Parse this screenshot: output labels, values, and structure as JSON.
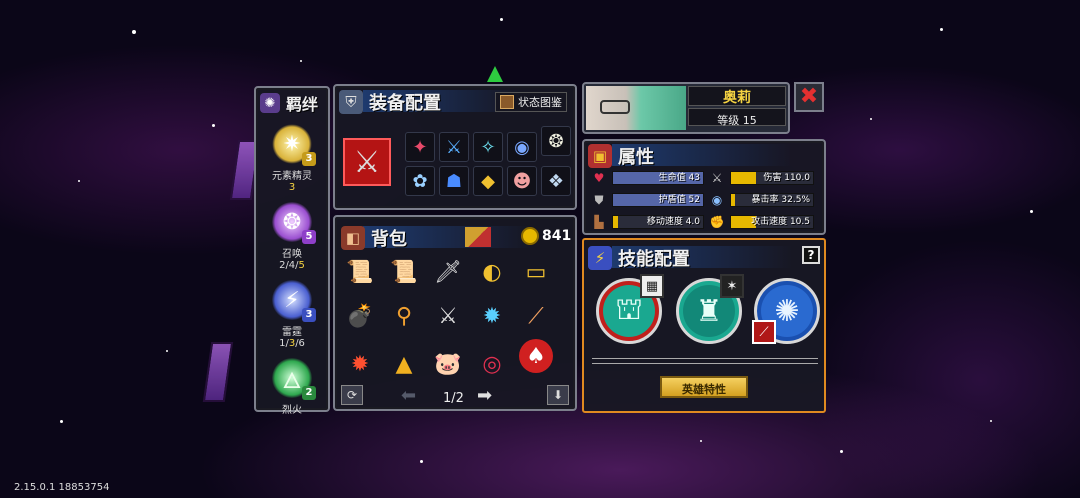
{
  "colors": {
    "panel_border": "#7c7f8c",
    "accent_gold": "#f5d342",
    "skill_panel_border": "#e08a20",
    "close_red": "#c62828",
    "hp_fill": "#5566a8",
    "gold_fill": "#e6b800"
  },
  "bond": {
    "title": "羁绊",
    "items": [
      {
        "name": "元素精灵",
        "count": "3",
        "badge": "3",
        "icon": "sun-star-icon"
      },
      {
        "name": "召唤",
        "count_parts": [
          "2/4/",
          "5"
        ],
        "badge": "5",
        "icon": "summon-swirl-icon"
      },
      {
        "name": "雷霆",
        "count_parts": [
          "1/",
          "3",
          "/6"
        ],
        "badge": "3",
        "icon": "lightning-icon"
      },
      {
        "name": "烈火",
        "count": "",
        "badge": "2",
        "icon": "flame-icon"
      }
    ]
  },
  "equipment": {
    "title": "装备配置",
    "status_button": "状态图鉴",
    "weapon_icon": "crossed-swords-icon",
    "slots": [
      "✦",
      "⚔",
      "✧",
      "◉",
      "❂",
      "✿",
      "☗",
      "◆",
      "☻",
      "❖"
    ]
  },
  "bag": {
    "title": "背包",
    "coins": "841",
    "page": "1/2",
    "items": [
      "📜",
      "📜",
      "🗡",
      "◐",
      "▭",
      "💣",
      "⚲",
      "⚔",
      "✹",
      "⟋",
      "✹",
      "▲",
      "🐷",
      "◎",
      "♠"
    ]
  },
  "profile": {
    "name": "奥莉",
    "level": "等级 15",
    "close_icon": "close-x-icon"
  },
  "attributes": {
    "title": "属性",
    "rows": [
      {
        "label": "生命值 43",
        "fill": 1.0,
        "color": "#5566a8",
        "icon": "heart-icon"
      },
      {
        "label": "伤害 110.0",
        "fill": 0.3,
        "color": "#e6b800",
        "icon": "sword-icon"
      },
      {
        "label": "护盾值 52",
        "fill": 1.0,
        "color": "#5566a8",
        "icon": "shield-icon"
      },
      {
        "label": "暴击率 32.5%",
        "fill": 0.05,
        "color": "#e6b800",
        "icon": "eye-icon"
      },
      {
        "label": "移动速度 4.0",
        "fill": 0.05,
        "color": "#e6b800",
        "icon": "boot-icon"
      },
      {
        "label": "攻击速度 10.5",
        "fill": 0.3,
        "color": "#e6b800",
        "icon": "fist-icon"
      }
    ]
  },
  "skills": {
    "title": "技能配置",
    "help": "?",
    "hero_trait_button": "英雄特性"
  },
  "footer": {
    "version": "2.15.0.1 18853754"
  }
}
